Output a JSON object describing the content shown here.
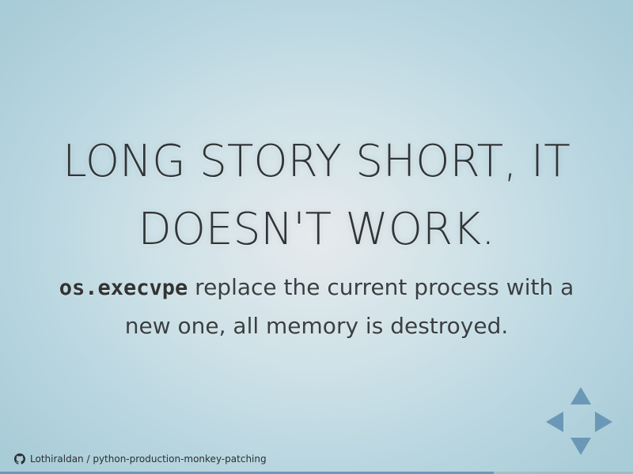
{
  "slide": {
    "headline_line1": "LONG STORY SHORT, IT",
    "headline_line2": "DOESN'T WORK.",
    "body_code": "os.execvpe",
    "body_text1": " replace the current process with a",
    "body_text2": "new one, all memory is destroyed."
  },
  "footer": {
    "icon": "github-icon",
    "link_text": "Lothiraldan / python-production-monkey-patching"
  },
  "controls": {
    "arrows": [
      "up",
      "left",
      "right",
      "down"
    ],
    "accent_color": "#6b98b6"
  },
  "progress": {
    "fraction": 0.78
  }
}
